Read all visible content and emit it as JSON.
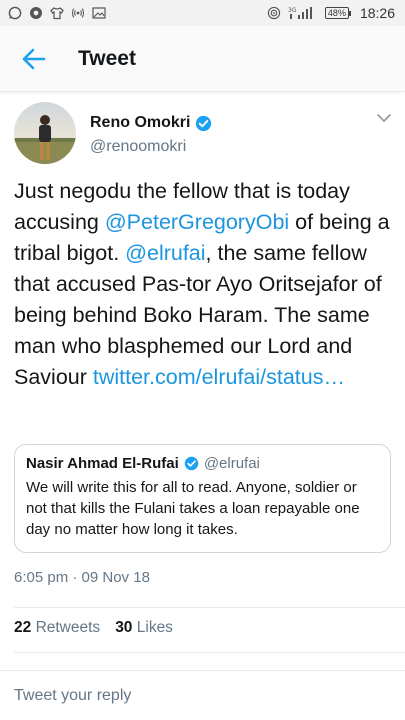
{
  "status_bar": {
    "time": "18:26",
    "battery": "48",
    "network": "3G",
    "icons": [
      "whatsapp-icon",
      "browser-icon",
      "shirt-icon",
      "broadcast-icon",
      "image-icon",
      "hotspot-icon",
      "signal-icon",
      "battery-icon"
    ]
  },
  "header": {
    "title": "Tweet",
    "back_icon": "back-arrow-icon"
  },
  "tweet": {
    "author_name": "Reno Omokri",
    "author_handle": "@renoomokri",
    "text_parts": [
      "Just negodu the fellow that is today accusing ",
      "@PeterGregoryObi",
      " of being a tribal bigot. ",
      "@elrufai",
      ", the same fellow that accused Pas-tor Ayo Oritsejafor of being behind Boko Haram. The same man who blasphemed our Lord and Saviour ",
      "twitter.com/elrufai/status…"
    ],
    "timestamp": "6:05 pm · 09 Nov 18",
    "retweets_count": "22",
    "retweets_label": "Retweets",
    "likes_count": "30",
    "likes_label": "Likes"
  },
  "quoted_tweet": {
    "author_name": "Nasir Ahmad El-Rufai",
    "author_handle": "@elrufai",
    "text": "We will write this for all to read. Anyone, soldier or not that kills the Fulani takes a loan repayable one day no matter how long it takes."
  },
  "reply": {
    "placeholder": "Tweet your reply"
  },
  "colors": {
    "accent": "#1da1f2",
    "link": "#1b95e0",
    "muted": "#657786"
  }
}
